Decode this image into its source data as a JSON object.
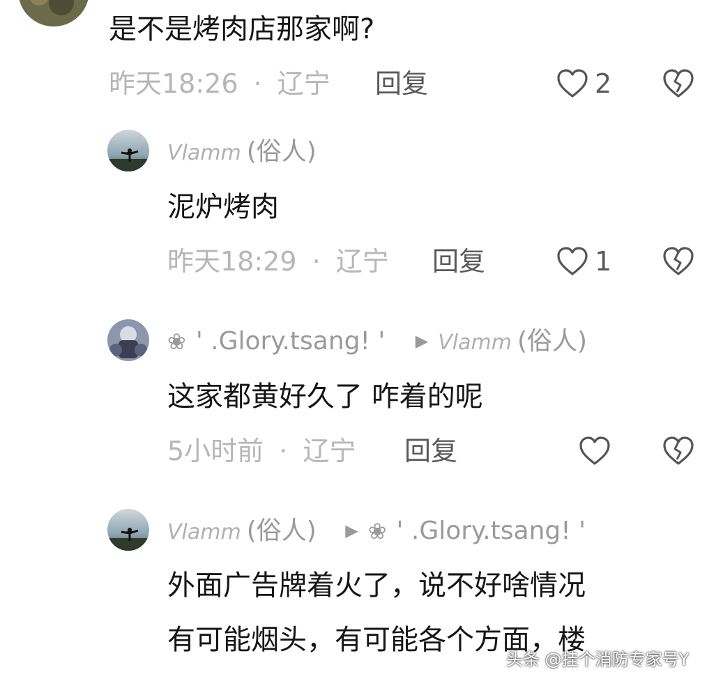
{
  "comments": [
    {
      "text": "是不是烤肉店那家啊?",
      "time": "昨天18:26",
      "location": "辽宁",
      "reply_label": "回复",
      "likes": "2"
    },
    {
      "username_scribble": "Vlamm",
      "username_suffix": "(俗人)",
      "text": "泥炉烤肉",
      "time": "昨天18:29",
      "location": "辽宁",
      "reply_label": "回复",
      "likes": "1"
    },
    {
      "username": "' .Glory.tsang! '",
      "reply_to_scribble": "Vlamm",
      "reply_to_suffix": "(俗人)",
      "text": "这家都黄好久了 咋着的呢",
      "time": "5小时前",
      "location": "辽宁",
      "reply_label": "回复",
      "likes": ""
    },
    {
      "username_scribble": "Vlamm",
      "username_suffix": "(俗人)",
      "reply_to": "' .Glory.tsang! '",
      "text_lines": [
        "外面广告牌着火了，说不好啥情况",
        "有可能烟头，有可能各个方面，楼"
      ]
    }
  ],
  "separator": "·",
  "watermark": "头条 @挂个消防专家号Y",
  "colors": {
    "text": "#161616",
    "meta": "#b6b6b6",
    "action": "#5a5a5a",
    "username": "#9a9a9a",
    "icon": "#555555"
  }
}
